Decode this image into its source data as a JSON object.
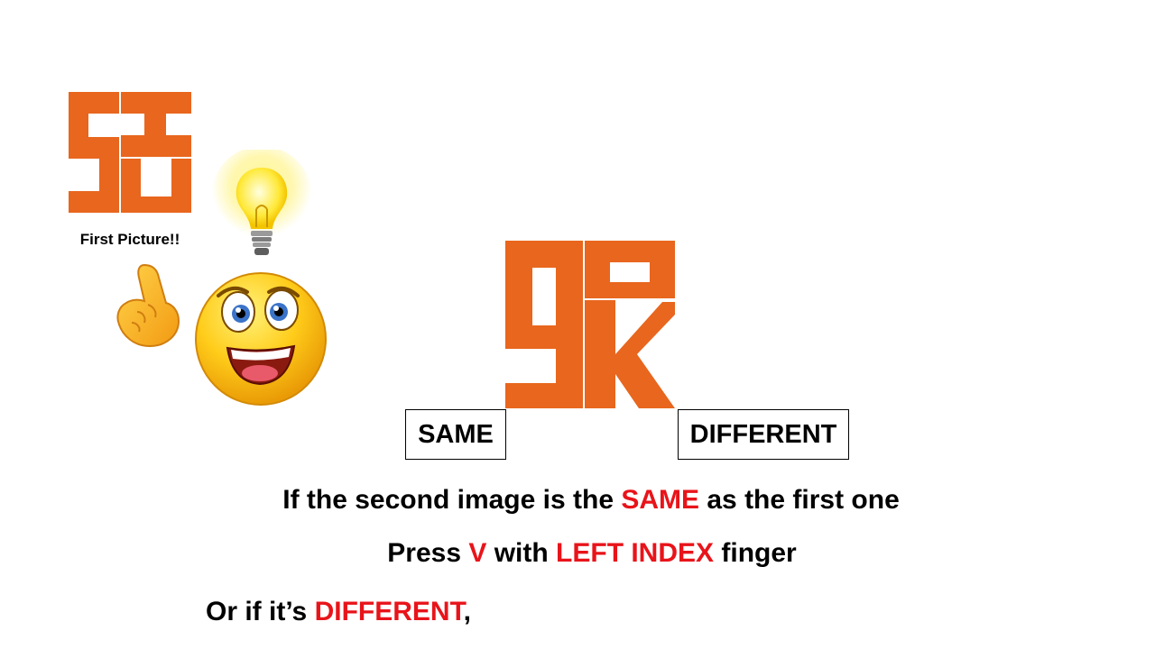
{
  "first_picture": {
    "caption": "First Picture!!",
    "glyph_color": "#E8661E"
  },
  "second_picture": {
    "glyph_color": "#E8661E"
  },
  "decorations": {
    "lightbulb": "lightbulb-icon",
    "pointing_hand": "pointing-up-hand-icon",
    "smiley": "laughing-smiley-face-icon"
  },
  "choices": {
    "same_label": "SAME",
    "different_label": "DIFFERENT"
  },
  "instructions": {
    "line1": {
      "before": "If the second image is the ",
      "highlight": "SAME",
      "after": " as the first one"
    },
    "line2": {
      "before": "Press ",
      "key": "V",
      "middle": " with ",
      "finger": "LEFT INDEX",
      "after": " finger"
    },
    "line3": {
      "before": "Or if it’s ",
      "highlight": "DIFFERENT",
      "after": ","
    }
  },
  "colors": {
    "glyph_orange": "#E8661E",
    "highlight_red": "#E8141A"
  }
}
